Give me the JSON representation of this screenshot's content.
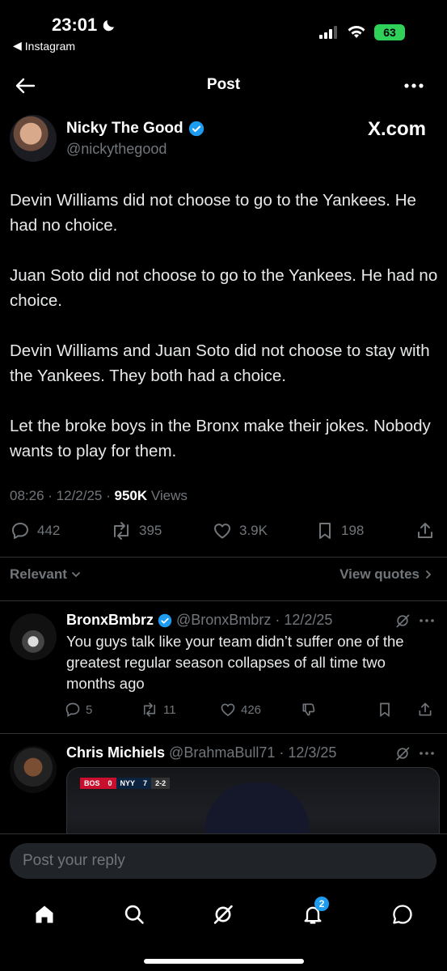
{
  "status_bar": {
    "time": "23:01",
    "back_app": "Instagram",
    "battery": "63"
  },
  "header": {
    "title": "Post"
  },
  "post": {
    "author": "Nicky The Good",
    "handle": "@nickythegood",
    "source": "X.com",
    "paragraphs": [
      "Devin Williams did not choose to go to the Yankees.  He had no choice.",
      "Juan Soto did not choose to go to the Yankees.  He had no choice.",
      "Devin Williams and Juan Soto did not choose to stay with the Yankees.  They both had a choice.",
      "Let the broke boys in the Bronx make their jokes.  Nobody wants to play for them."
    ],
    "time": "08:26",
    "date": "12/2/25",
    "views": "950K",
    "views_label": "Views",
    "replies": "442",
    "reposts": "395",
    "likes": "3.9K",
    "bookmarks": "198"
  },
  "filters": {
    "sort": "Relevant",
    "view_quotes": "View quotes"
  },
  "replies": [
    {
      "name": "BronxBmbrz",
      "handle": "@BronxBmbrz",
      "date": "12/2/25",
      "text": "You guys talk like your team didn’t suffer one of the greatest regular season collapses of all time two months ago",
      "replies": "5",
      "reposts": "11",
      "likes": "426"
    },
    {
      "name": "Chris Michiels",
      "handle": "@BrahmaBull71",
      "date": "12/3/25",
      "media_score": {
        "away": "BOS",
        "away_runs": "0",
        "home": "NYY",
        "home_runs": "7",
        "count": "2-2"
      }
    }
  ],
  "reply_input": {
    "placeholder": "Post your reply"
  },
  "nav": {
    "notifications_badge": "2"
  },
  "colors": {
    "accent": "#1d9bf0",
    "background": "#000000",
    "secondary_text": "#71767b",
    "battery": "#30d158"
  }
}
